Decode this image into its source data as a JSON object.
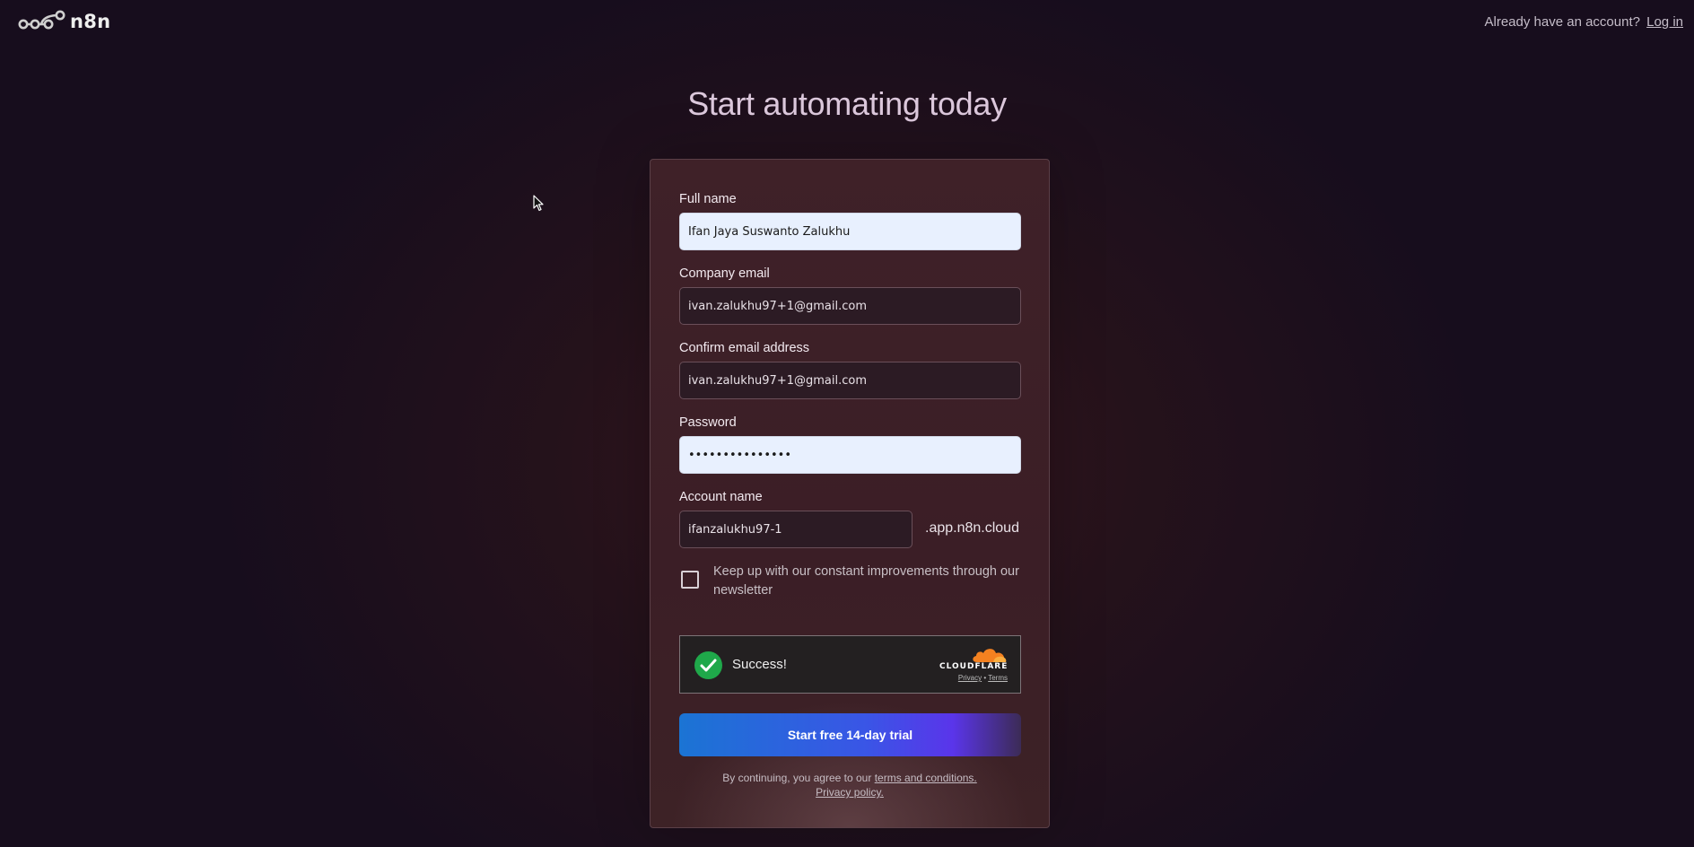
{
  "header": {
    "logo_text": "n8n",
    "logo_icon": "n8n-nodes-icon",
    "already_account_text": "Already have an account?",
    "login_link": "Log in"
  },
  "headline": "Start automating today",
  "form": {
    "full_name": {
      "label": "Full name",
      "value": "Ifan Jaya Suswanto Zalukhu"
    },
    "company_email": {
      "label": "Company email",
      "value": "ivan.zalukhu97+1@gmail.com"
    },
    "confirm_email": {
      "label": "Confirm email address",
      "value": "ivan.zalukhu97+1@gmail.com"
    },
    "password": {
      "label": "Password",
      "value": "•••••••••••••••"
    },
    "account_name": {
      "label": "Account name",
      "value": "ifanzalukhu97-1",
      "suffix": ".app.n8n.cloud"
    },
    "newsletter": {
      "checked": false,
      "label": "Keep up with our constant improvements through our newsletter"
    },
    "captcha": {
      "status": "Success!",
      "provider": "CLOUDFLARE",
      "privacy_link": "Privacy",
      "separator": "•",
      "terms_link": "Terms"
    },
    "submit_label": "Start free 14-day trial",
    "terms_text": "By continuing, you agree to our",
    "terms_link": "terms and conditions.",
    "privacy_link": "Privacy policy."
  },
  "colors": {
    "background": "#1a0f1d",
    "card": "#3d2027",
    "cta_start": "#1b74d4",
    "cta_end": "#5a35ea",
    "success_green": "#1fa84a",
    "cloudflare_orange": "#f48120"
  }
}
